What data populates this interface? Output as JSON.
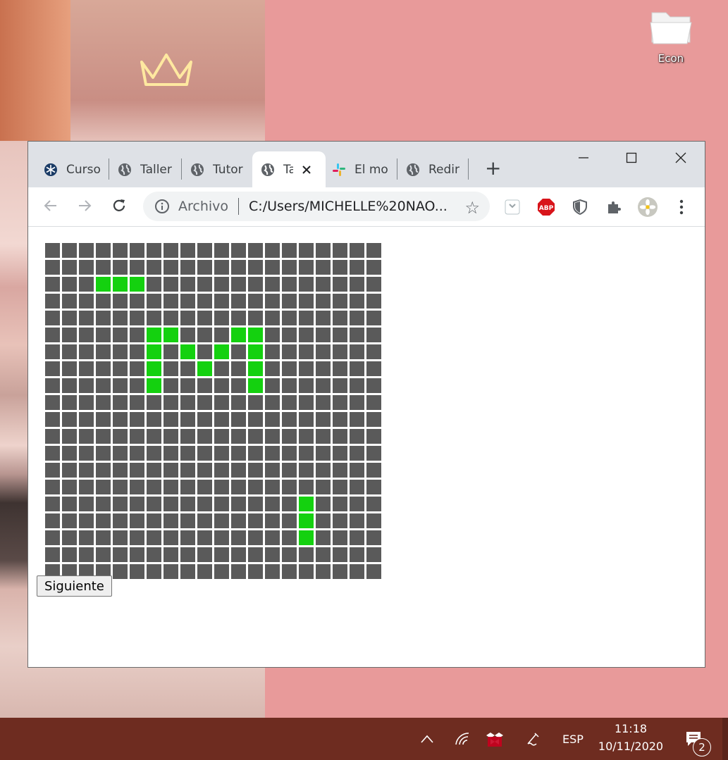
{
  "desktop": {
    "icon_label": "Econ"
  },
  "browser": {
    "tabs": [
      {
        "title": "Curso",
        "icon": "snowflake-icon",
        "active": false
      },
      {
        "title": "Taller",
        "icon": "globe-icon",
        "active": false
      },
      {
        "title": "Tutor",
        "icon": "globe-icon",
        "active": false
      },
      {
        "title": "Ta",
        "icon": "globe-icon",
        "active": true
      },
      {
        "title": "El mo",
        "icon": "slack-icon",
        "active": false
      },
      {
        "title": "Redir",
        "icon": "globe-icon",
        "active": false
      }
    ],
    "new_tab_label": "+",
    "address": {
      "scheme_label": "Archivo",
      "url": "C:/Users/MICHELLE%20NAO..."
    },
    "extensions": [
      "pocket-icon",
      "adblock-icon",
      "shield-icon",
      "puzzle-icon",
      "profile-avatar",
      "menu-icon"
    ],
    "abp_label": "ABP"
  },
  "page": {
    "grid": {
      "rows": 20,
      "cols": 20,
      "live_cells": [
        [
          2,
          3
        ],
        [
          2,
          4
        ],
        [
          2,
          5
        ],
        [
          5,
          6
        ],
        [
          5,
          7
        ],
        [
          5,
          11
        ],
        [
          5,
          12
        ],
        [
          6,
          6
        ],
        [
          6,
          8
        ],
        [
          6,
          10
        ],
        [
          6,
          12
        ],
        [
          7,
          6
        ],
        [
          7,
          9
        ],
        [
          7,
          12
        ],
        [
          8,
          6
        ],
        [
          8,
          12
        ],
        [
          15,
          15
        ],
        [
          16,
          15
        ],
        [
          17,
          15
        ]
      ],
      "live_color": "#14d10f",
      "dead_color": "#5a5a5a"
    },
    "next_button_label": "Siguiente"
  },
  "taskbar": {
    "language": "ESP",
    "time": "11:18",
    "date": "10/11/2020",
    "notification_count": "2"
  }
}
